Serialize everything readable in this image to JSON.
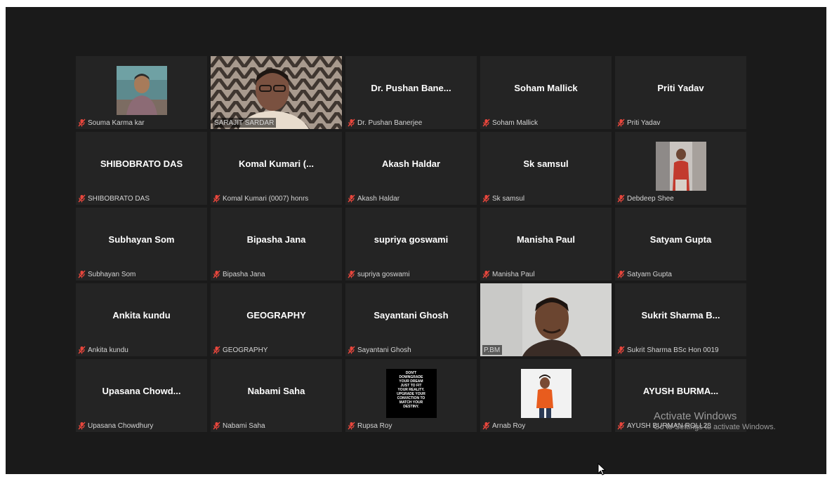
{
  "participants": [
    {
      "display": "",
      "label": "Souma Karma kar"
    },
    {
      "display": "",
      "label": "SARAJIT SARDAR"
    },
    {
      "display": "Dr. Pushan Bane...",
      "label": "Dr. Pushan Banerjee"
    },
    {
      "display": "Soham Mallick",
      "label": "Soham Mallick"
    },
    {
      "display": "Priti Yadav",
      "label": "Priti Yadav"
    },
    {
      "display": "SHIBOBRATO DAS",
      "label": "SHIBOBRATO DAS"
    },
    {
      "display": "Komal Kumari (...",
      "label": "Komal Kumari (0007) honrs"
    },
    {
      "display": "Akash Haldar",
      "label": "Akash Haldar"
    },
    {
      "display": "Sk samsul",
      "label": "Sk samsul"
    },
    {
      "display": "",
      "label": "Debdeep Shee"
    },
    {
      "display": "Subhayan Som",
      "label": "Subhayan Som"
    },
    {
      "display": "Bipasha Jana",
      "label": "Bipasha Jana"
    },
    {
      "display": "supriya goswami",
      "label": "supriya goswami"
    },
    {
      "display": "Manisha Paul",
      "label": "Manisha Paul"
    },
    {
      "display": "Satyam Gupta",
      "label": "Satyam Gupta"
    },
    {
      "display": "Ankita kundu",
      "label": "Ankita kundu"
    },
    {
      "display": "GEOGRAPHY",
      "label": "GEOGRAPHY"
    },
    {
      "display": "Sayantani Ghosh",
      "label": "Sayantani Ghosh"
    },
    {
      "display": "",
      "label": "P.BM"
    },
    {
      "display": "Sukrit Sharma B...",
      "label": "Sukrit Sharma BSc Hon 0019"
    },
    {
      "display": "Upasana  Chowd...",
      "label": "Upasana Chowdhury"
    },
    {
      "display": "Nabami Saha",
      "label": "Nabami Saha"
    },
    {
      "display": "",
      "label": "Rupsa Roy"
    },
    {
      "display": "",
      "label": "Arnab Roy"
    },
    {
      "display": "AYUSH BURMA...",
      "label": "AYUSH BURMAN ROLL28"
    }
  ],
  "poster_lines": [
    "DON'T",
    "DOWNGRADE",
    "YOUR DREAM",
    "JUST TO FIT",
    "YOUR REALITY.",
    "UPGRADE YOUR",
    "CONVICTION TO",
    "MATCH YOUR",
    "DESTINY."
  ],
  "watermark": {
    "line1": "Activate Windows",
    "line2": "Go to Settings to activate Windows."
  },
  "colors": {
    "speaker_border": "#c9e05a",
    "muted_mic": "#e8463c",
    "tile_bg": "#242424"
  }
}
